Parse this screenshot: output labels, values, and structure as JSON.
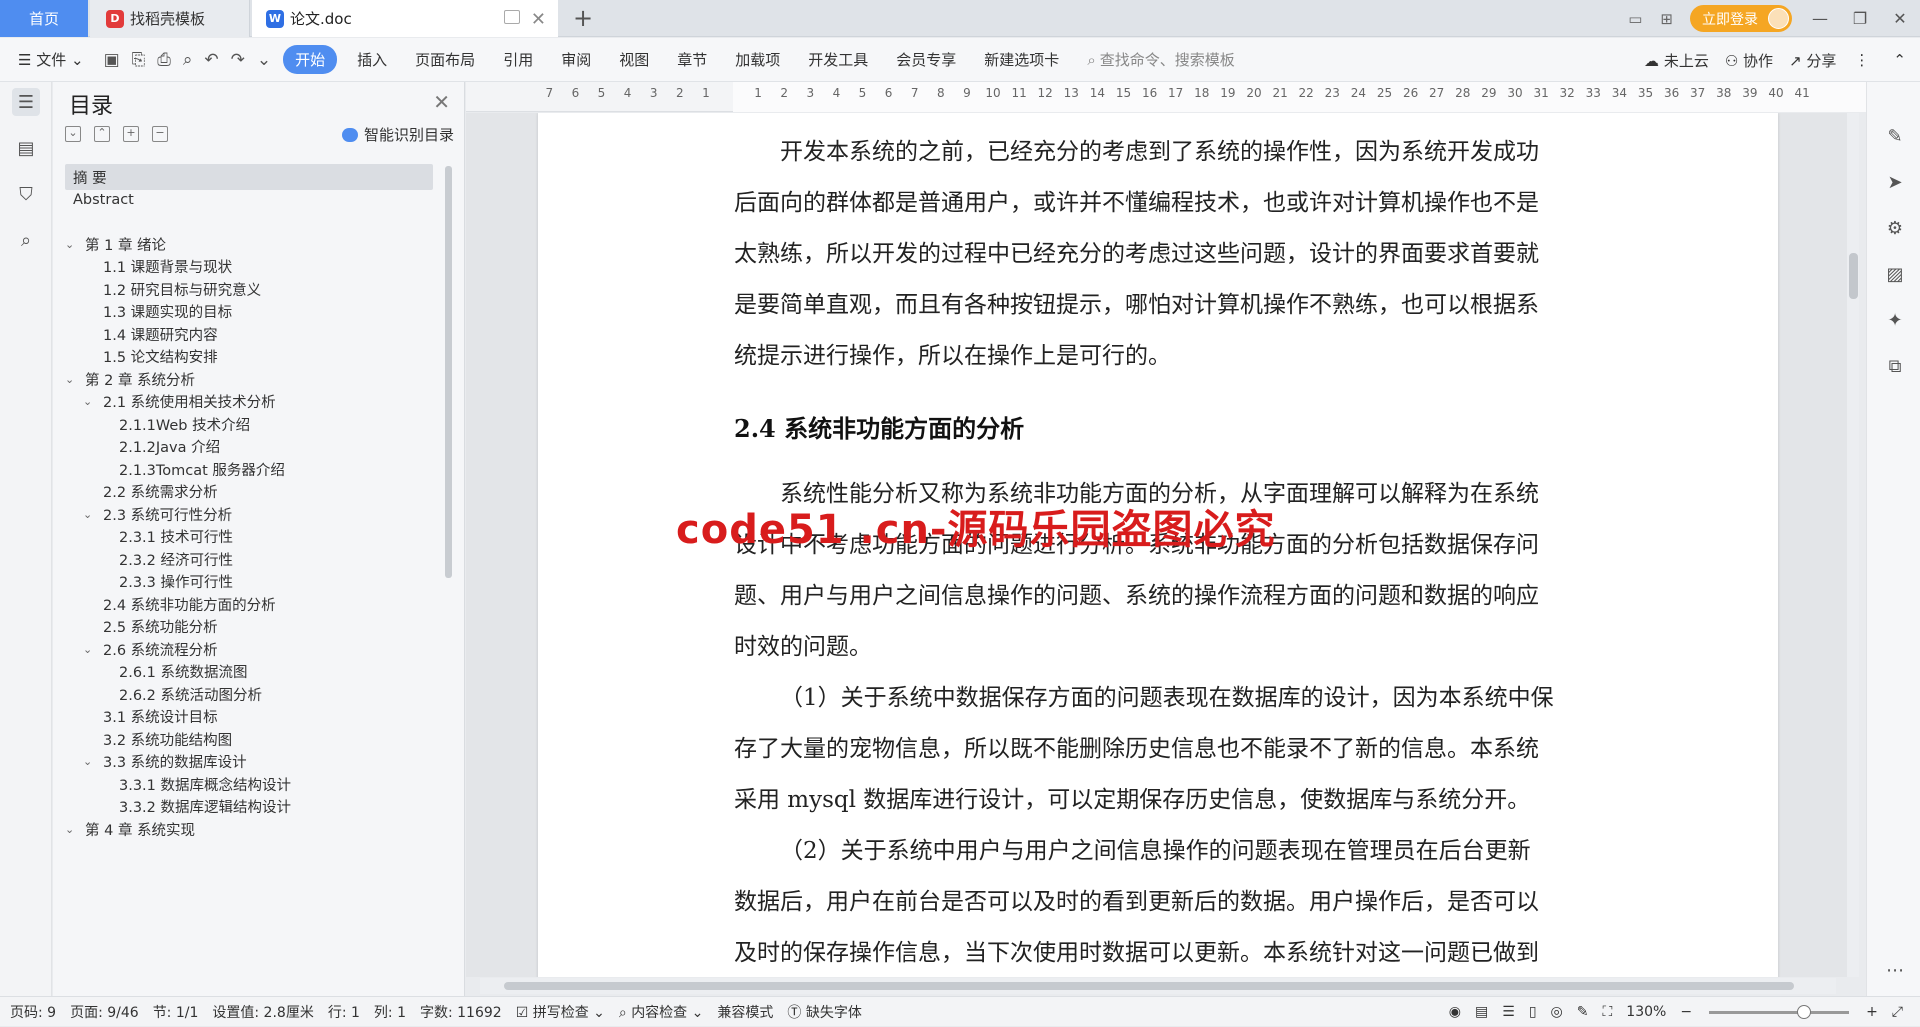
{
  "tabs": {
    "home": "首页",
    "template": "找稻壳模板",
    "doc": "论文.doc"
  },
  "title_bar": {
    "login": "立即登录"
  },
  "toolbar": {
    "file": "文件",
    "tabs": [
      "开始",
      "插入",
      "页面布局",
      "引用",
      "审阅",
      "视图",
      "章节",
      "加载项",
      "开发工具",
      "会员专享",
      "新建选项卡"
    ],
    "active_tab": "开始",
    "search_placeholder": "查找命令、搜索模板",
    "cloud": "未上云",
    "collab": "协作",
    "share": "分享"
  },
  "toc": {
    "title": "目录",
    "smart": "智能识别目录",
    "items": [
      {
        "label": "摘  要",
        "level": 0,
        "chev": ""
      },
      {
        "label": "Abstract",
        "level": 0,
        "chev": ""
      },
      {
        "label": "第 1 章  绪论",
        "level": 0,
        "chev": "v"
      },
      {
        "label": "1.1 课题背景与现状",
        "level": 1,
        "chev": ""
      },
      {
        "label": "1.2 研究目标与研究意义",
        "level": 1,
        "chev": ""
      },
      {
        "label": "1.3 课题实现的目标",
        "level": 1,
        "chev": ""
      },
      {
        "label": "1.4  课题研究内容",
        "level": 1,
        "chev": ""
      },
      {
        "label": "1.5  论文结构安排",
        "level": 1,
        "chev": ""
      },
      {
        "label": "第 2 章  系统分析",
        "level": 0,
        "chev": "v"
      },
      {
        "label": "2.1 系统使用相关技术分析",
        "level": 1,
        "chev": "v"
      },
      {
        "label": "2.1.1Web 技术介绍",
        "level": 2,
        "chev": ""
      },
      {
        "label": "2.1.2Java 介绍",
        "level": 2,
        "chev": ""
      },
      {
        "label": "2.1.3Tomcat 服务器介绍",
        "level": 2,
        "chev": ""
      },
      {
        "label": "2.2 系统需求分析",
        "level": 1,
        "chev": ""
      },
      {
        "label": "2.3 系统可行性分析",
        "level": 1,
        "chev": "v"
      },
      {
        "label": "2.3.1 技术可行性",
        "level": 2,
        "chev": ""
      },
      {
        "label": "2.3.2 经济可行性",
        "level": 2,
        "chev": ""
      },
      {
        "label": "2.3.3 操作可行性",
        "level": 2,
        "chev": ""
      },
      {
        "label": "2.4 系统非功能方面的分析",
        "level": 1,
        "chev": ""
      },
      {
        "label": "2.5 系统功能分析",
        "level": 1,
        "chev": ""
      },
      {
        "label": "2.6 系统流程分析",
        "level": 1,
        "chev": "v"
      },
      {
        "label": "2.6.1 系统数据流图",
        "level": 2,
        "chev": ""
      },
      {
        "label": "2.6.2 系统活动图分析",
        "level": 2,
        "chev": ""
      },
      {
        "label": "3.1 系统设计目标",
        "level": 1,
        "chev": ""
      },
      {
        "label": "3.2 系统功能结构图",
        "level": 1,
        "chev": ""
      },
      {
        "label": "3.3 系统的数据库设计",
        "level": 1,
        "chev": "v"
      },
      {
        "label": "3.3.1 数据库概念结构设计",
        "level": 2,
        "chev": ""
      },
      {
        "label": "3.3.2 数据库逻辑结构设计",
        "level": 2,
        "chev": ""
      },
      {
        "label": "第 4 章  系统实现",
        "level": 0,
        "chev": "v"
      }
    ]
  },
  "ruler": [
    "7",
    "6",
    "5",
    "4",
    "3",
    "2",
    "1",
    "",
    "1",
    "2",
    "3",
    "4",
    "5",
    "6",
    "7",
    "8",
    "9",
    "10",
    "11",
    "12",
    "13",
    "14",
    "15",
    "16",
    "17",
    "18",
    "19",
    "20",
    "21",
    "22",
    "23",
    "24",
    "25",
    "26",
    "27",
    "28",
    "29",
    "30",
    "31",
    "32",
    "33",
    "34",
    "35",
    "36",
    "37",
    "38",
    "39",
    "40",
    "41"
  ],
  "doc": {
    "p1_lines": [
      "开发本系统的之前，已经充分的考虑到了系统的操作性，因为系统开发成功",
      "后面向的群体都是普通用户，或许并不懂编程技术，也或许对计算机操作也不是",
      "太熟练，所以开发的过程中已经充分的考虑过这些问题，设计的界面要求首要就",
      "是要简单直观，而且有各种按钮提示，哪怕对计算机操作不熟练，也可以根据系",
      "统提示进行操作，所以在操作上是可行的。"
    ],
    "heading": "2.4 系统非功能方面的分析",
    "p2_lines": [
      "系统性能分析又称为系统非功能方面的分析，从字面理解可以解释为在系统",
      "设计中不考虑功能方面的问题进行分析。系统非功能方面的分析包括数据保存问",
      "题、用户与用户之间信息操作的问题、系统的操作流程方面的问题和数据的响应",
      "时效的问题。"
    ],
    "p3_lines": [
      "（1）关于系统中数据保存方面的问题表现在数据库的设计，因为本系统中保",
      "存了大量的宠物信息，所以既不能删除历史信息也不能录不了新的信息。本系统",
      "采用 mysql 数据库进行设计，可以定期保存历史信息，使数据库与系统分开。"
    ],
    "p4_lines": [
      "（2）关于系统中用户与用户之间信息操作的问题表现在管理员在后台更新",
      "数据后，用户在前台是否可以及时的看到更新后的数据。用户操作后，是否可以",
      "及时的保存操作信息，当下次使用时数据可以更新。本系统针对这一问题已做到"
    ],
    "watermark": "code51 .cn-源码乐园盗图必究"
  },
  "status": {
    "page": "页码: 9",
    "pages": "页面: 9/46",
    "section": "节: 1/1",
    "setting": "设置值: 2.8厘米",
    "row": "行: 1",
    "col": "列: 1",
    "words": "字数: 11692",
    "spell": "拼写检查",
    "content": "内容检查",
    "compat": "兼容模式",
    "font": "缺失字体",
    "zoom": "130%"
  }
}
